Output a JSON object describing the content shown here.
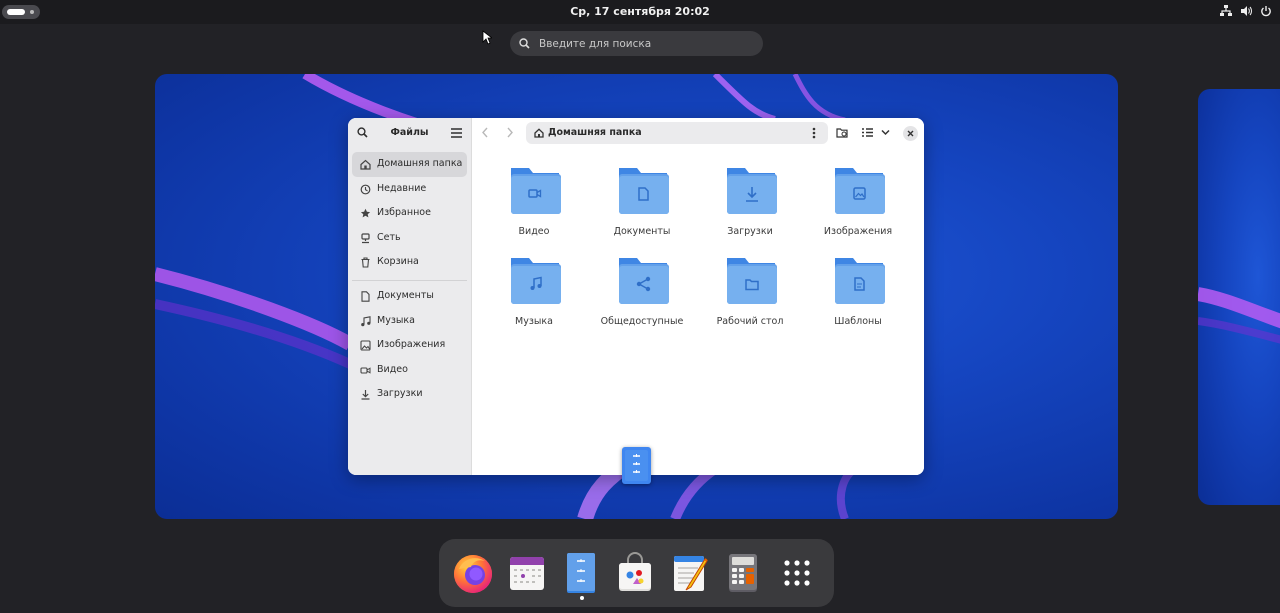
{
  "topbar": {
    "clock": "Ср, 17 сентября  20:02",
    "tray_icons": [
      "network-icon",
      "volume-icon",
      "power-icon"
    ]
  },
  "search": {
    "placeholder": "Введите для поиска"
  },
  "files": {
    "title": "Файлы",
    "path_label": "Домашняя папка",
    "sidebar": {
      "places": [
        {
          "label": "Домашняя папка",
          "icon": "home-icon",
          "active": true
        },
        {
          "label": "Недавние",
          "icon": "clock-icon"
        },
        {
          "label": "Избранное",
          "icon": "star-icon"
        },
        {
          "label": "Сеть",
          "icon": "network-icon"
        },
        {
          "label": "Корзина",
          "icon": "trash-icon"
        }
      ],
      "bookmarks": [
        {
          "label": "Документы",
          "icon": "document-icon"
        },
        {
          "label": "Музыка",
          "icon": "music-icon"
        },
        {
          "label": "Изображения",
          "icon": "image-icon"
        },
        {
          "label": "Видео",
          "icon": "video-icon"
        },
        {
          "label": "Загрузки",
          "icon": "download-icon"
        }
      ]
    },
    "folders": [
      {
        "name": "Видео",
        "emblem": "video"
      },
      {
        "name": "Документы",
        "emblem": "document"
      },
      {
        "name": "Загрузки",
        "emblem": "download"
      },
      {
        "name": "Изображения",
        "emblem": "image"
      },
      {
        "name": "Музыка",
        "emblem": "music"
      },
      {
        "name": "Общедоступные",
        "emblem": "share"
      },
      {
        "name": "Рабочий стол",
        "emblem": "desktop"
      },
      {
        "name": "Шаблоны",
        "emblem": "template"
      }
    ]
  },
  "dock": {
    "apps": [
      "firefox",
      "calendar",
      "files",
      "software",
      "text-editor",
      "calculator",
      "app-grid"
    ],
    "running": "files"
  },
  "colors": {
    "folder": "#62a0ea",
    "folder_dark": "#3f86e4",
    "wallpaper": "#1545c0",
    "accent_purple": "#b24ef0"
  }
}
